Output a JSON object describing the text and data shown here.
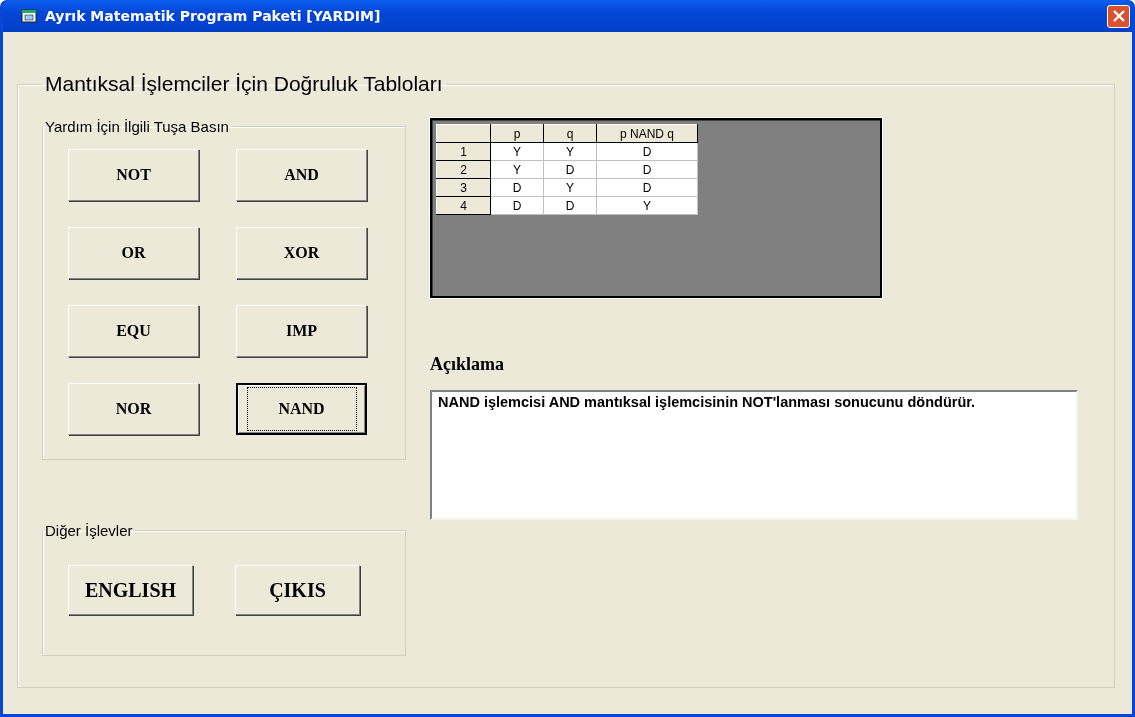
{
  "window": {
    "title": "Ayrık Matematik Program Paketi [YARDIM]"
  },
  "main_group": {
    "title": "Mantıksal İşlemciler İçin Doğruluk Tabloları"
  },
  "help_group": {
    "title": "Yardım İçin İlgili  Tuşa Basın",
    "buttons": [
      {
        "label": "NOT",
        "selected": false
      },
      {
        "label": "AND",
        "selected": false
      },
      {
        "label": "OR",
        "selected": false
      },
      {
        "label": "XOR",
        "selected": false
      },
      {
        "label": "EQU",
        "selected": false
      },
      {
        "label": "IMP",
        "selected": false
      },
      {
        "label": "NOR",
        "selected": false
      },
      {
        "label": "NAND",
        "selected": true
      }
    ]
  },
  "other_group": {
    "title": "Diğer İşlevler",
    "buttons": [
      {
        "label": "ENGLISH",
        "selected": false
      },
      {
        "label": "ÇIKIS",
        "selected": false
      }
    ]
  },
  "truth_table": {
    "columns": [
      "p",
      "q",
      "p NAND q"
    ],
    "rows": [
      {
        "header": "1",
        "cells": [
          "Y",
          "Y",
          "D"
        ]
      },
      {
        "header": "2",
        "cells": [
          "Y",
          "D",
          "D"
        ]
      },
      {
        "header": "3",
        "cells": [
          "D",
          "Y",
          "D"
        ]
      },
      {
        "header": "4",
        "cells": [
          "D",
          "D",
          "Y"
        ]
      }
    ]
  },
  "description": {
    "heading": "Açıklama",
    "text": "NAND işlemcisi AND mantıksal işlemcisinin NOT'lanması sonucunu döndürür."
  }
}
